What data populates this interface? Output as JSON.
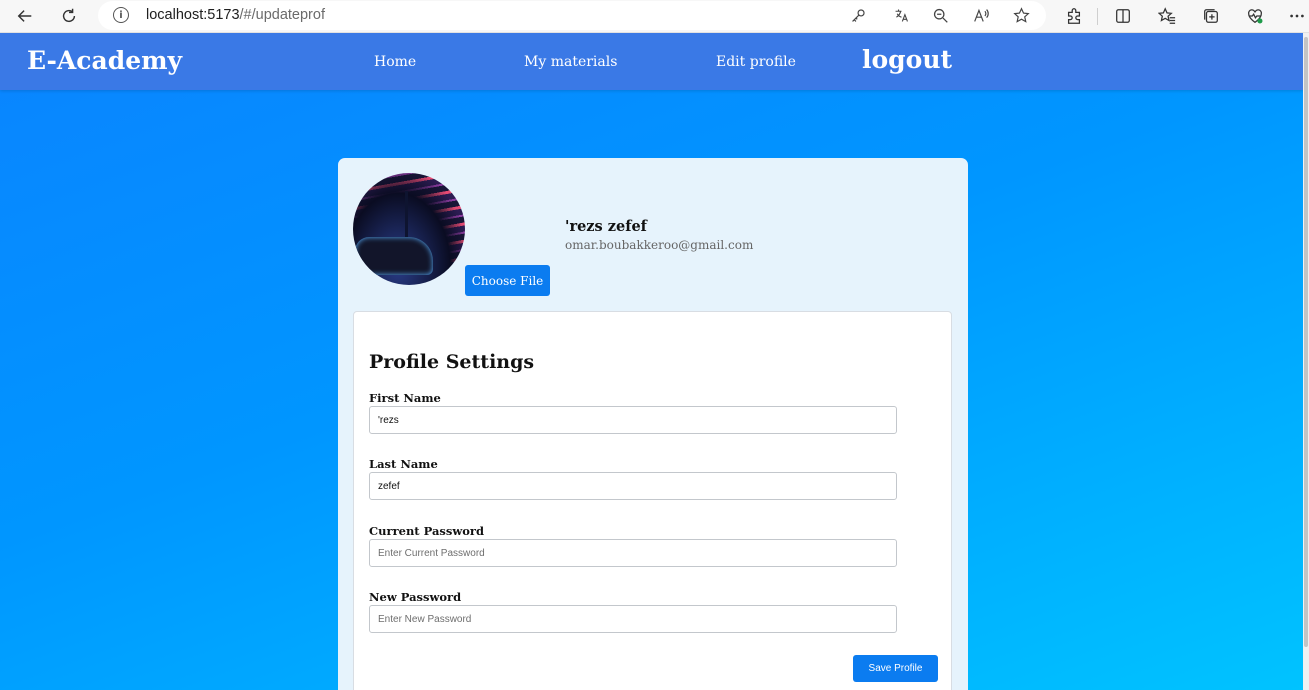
{
  "browser": {
    "url_host": "localhost:5173",
    "url_path": "/#/updateprof"
  },
  "navbar": {
    "brand": "E-Academy",
    "links": [
      "Home",
      "My materials",
      "Edit profile"
    ],
    "logout": "logout"
  },
  "profile": {
    "name": "'rezs zefef",
    "email": "omar.boubakkeroo@gmail.com",
    "choose_file_label": "Choose File"
  },
  "settings": {
    "title": "Profile Settings",
    "fields": [
      {
        "label": "First Name",
        "value": "'rezs",
        "placeholder": ""
      },
      {
        "label": "Last Name",
        "value": "zefef",
        "placeholder": ""
      },
      {
        "label": "Current Password",
        "value": "",
        "placeholder": "Enter Current Password"
      },
      {
        "label": "New Password",
        "value": "",
        "placeholder": "Enter New Password"
      }
    ],
    "save_label": "Save Profile"
  },
  "colors": {
    "navbar": "#3a79e6",
    "button": "#0b7cf0",
    "card": "#e6f3fc"
  }
}
